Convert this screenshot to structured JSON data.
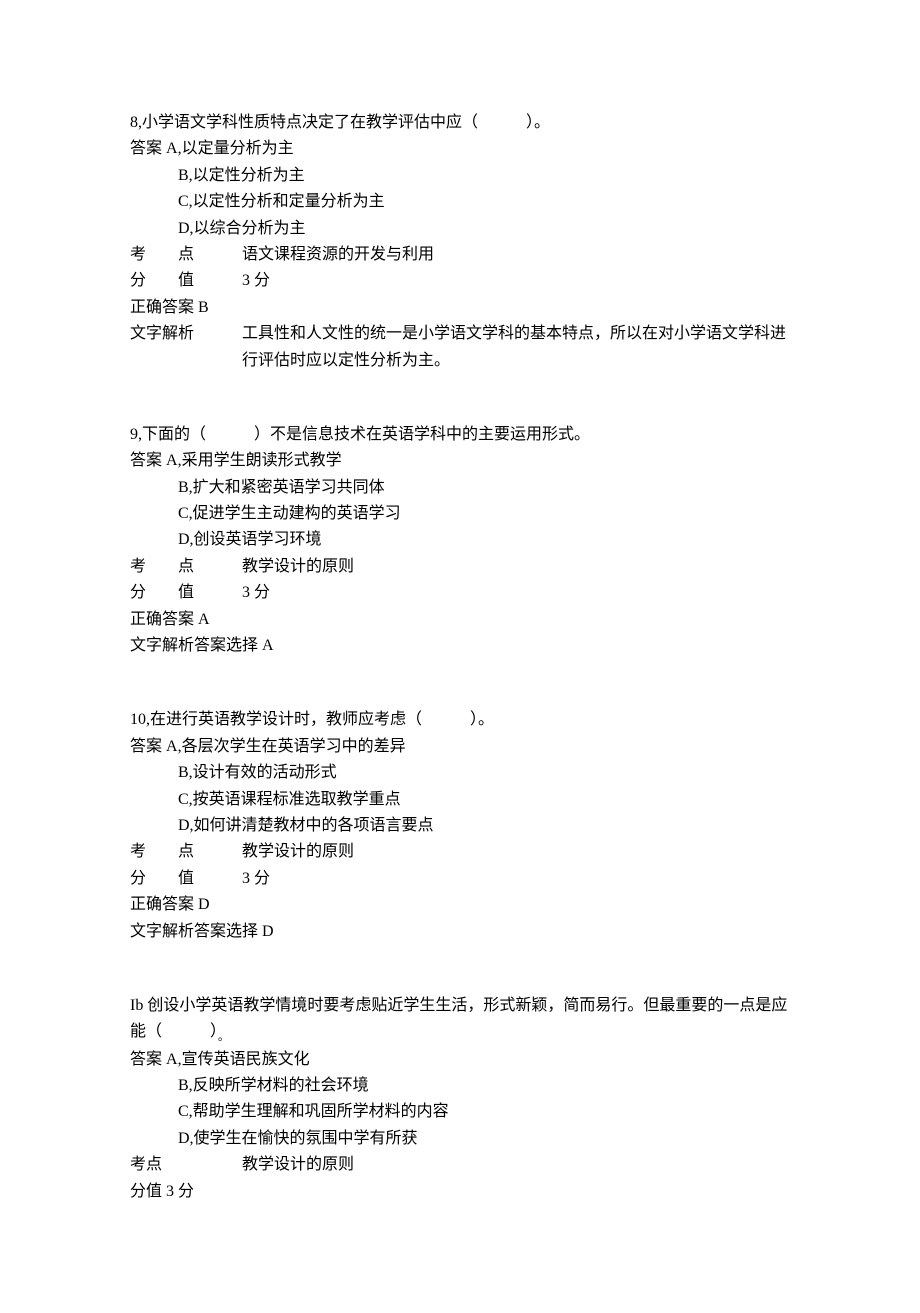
{
  "questions": [
    {
      "number": "8",
      "stem": "小学语文学科性质特点决定了在教学评估中应（　　　）。",
      "answer_prefix": "答案",
      "options": [
        "A,以定量分析为主",
        "B,以定性分析为主",
        "C,以定性分析和定量分析为主",
        "D,以综合分析为主"
      ],
      "kaodian_label": "考　　点",
      "kaodian": "语文课程资源的开发与利用",
      "fenzhi_label": "分　　值",
      "fenzhi": "3 分",
      "correct_label": "正确答案",
      "correct": "B",
      "jiexi_label": "文字解析",
      "jiexi": "工具性和人文性的统一是小学语文学科的基本特点，所以在对小学语文学科进行评估时应以定性分析为主。"
    },
    {
      "number": "9",
      "stem": "下面的（　　　）不是信息技术在英语学科中的主要运用形式。",
      "answer_prefix": "答案",
      "options": [
        "A,采用学生朗读形式教学",
        "B,扩大和紧密英语学习共同体",
        "C,促进学生主动建构的英语学习",
        "D,创设英语学习环境"
      ],
      "kaodian_label": "考　　点",
      "kaodian": "教学设计的原则",
      "fenzhi_label": "分　　值",
      "fenzhi": "3 分",
      "correct_label": "正确答案",
      "correct": "A",
      "jiexi_label": "文字解析",
      "jiexi": "答案选择 A"
    },
    {
      "number": "10",
      "stem": "在进行英语教学设计时，教师应考虑（　　　）。",
      "answer_prefix": "答案",
      "options": [
        "A,各层次学生在英语学习中的差异",
        "B,设计有效的活动形式",
        "C,按英语课程标准选取教学重点",
        "D,如何讲清楚教材中的各项语言要点"
      ],
      "kaodian_label": "考　　点",
      "kaodian": "教学设计的原则",
      "fenzhi_label": "分　　值",
      "fenzhi": "3 分",
      "correct_label": "正确答案",
      "correct": "D",
      "jiexi_label": "文字解析",
      "jiexi": "答案选择 D"
    },
    {
      "number": "Ib",
      "stem": "创设小学英语教学情境时要考虑贴近学生生活，形式新颖，简而易行。但最重要的一点是应能（　　　）",
      "stem_suffix": "。",
      "answer_prefix": "答案",
      "options": [
        "A,宣传英语民族文化",
        "B,反映所学材料的社会环境",
        "C,帮助学生理解和巩固所学材料的内容",
        "D,使学生在愉快的氛围中学有所获"
      ],
      "kaodian_label": "考点",
      "kaodian": "教学设计的原则",
      "fenzhi_label": "分值",
      "fenzhi": "3 分",
      "correct_label": "",
      "correct": "",
      "jiexi_label": "",
      "jiexi": ""
    }
  ]
}
